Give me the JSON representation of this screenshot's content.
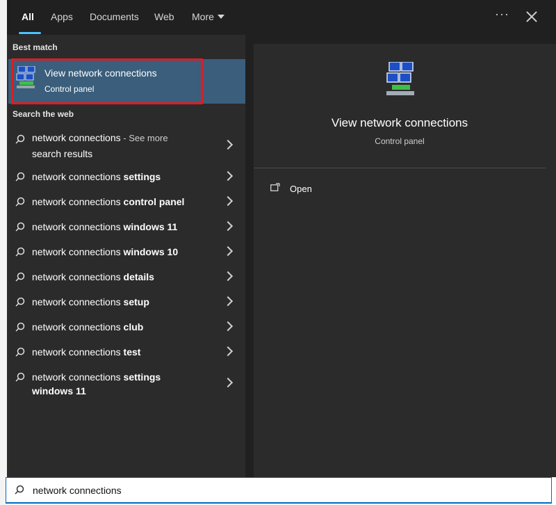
{
  "tabs": [
    {
      "label": "All"
    },
    {
      "label": "Apps"
    },
    {
      "label": "Documents"
    },
    {
      "label": "Web"
    },
    {
      "label": "More"
    }
  ],
  "topbar": {
    "ellipsis": "···"
  },
  "best_match": {
    "heading": "Best match",
    "title": "View network connections",
    "subtitle": "Control panel"
  },
  "web": {
    "heading": "Search the web",
    "first": {
      "base": "network connections",
      "see_more": " - See more",
      "sub": "search results"
    },
    "suggestions": [
      {
        "base": "network connections ",
        "bold": "settings"
      },
      {
        "base": "network connections ",
        "bold": "control panel"
      },
      {
        "base": "network connections ",
        "bold": "windows 11"
      },
      {
        "base": "network connections ",
        "bold": "windows 10"
      },
      {
        "base": "network connections ",
        "bold": "details"
      },
      {
        "base": "network connections ",
        "bold": "setup"
      },
      {
        "base": "network connections ",
        "bold": "club"
      },
      {
        "base": "network connections ",
        "bold": "test"
      }
    ],
    "last": {
      "base": "network connections ",
      "bold": "settings",
      "bold2": "windows 11"
    }
  },
  "preview": {
    "title": "View network connections",
    "subtitle": "Control panel",
    "action": "Open"
  },
  "search": {
    "query": "network connections"
  },
  "colors": {
    "accent": "#4cc2ff",
    "highlight": "#3a5e7c",
    "annotation": "#e11b22"
  }
}
